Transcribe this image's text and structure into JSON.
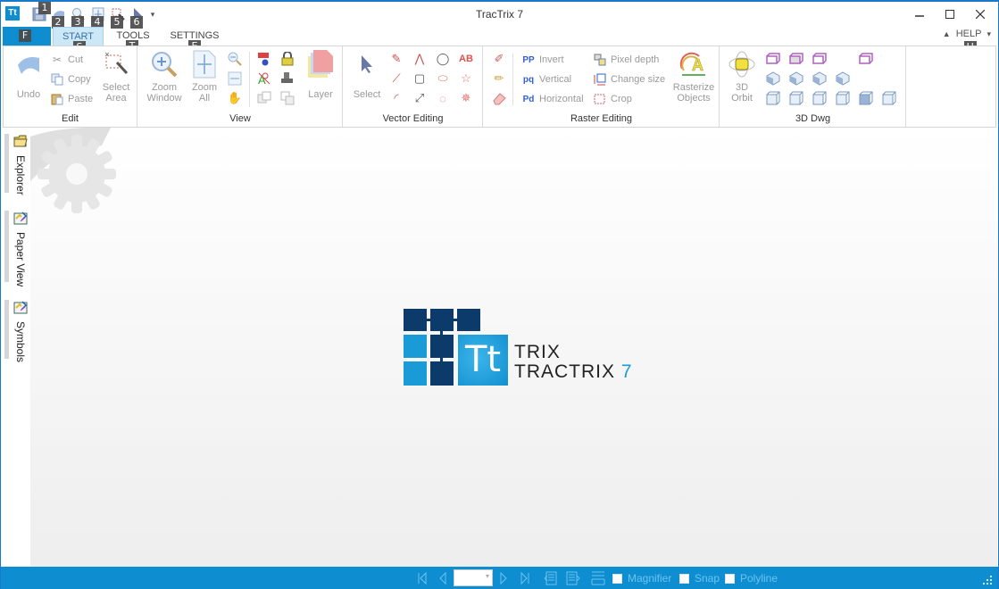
{
  "window": {
    "title": "TracTrix 7",
    "app_icon_text": "Tt",
    "minimize_icon": "minimize-icon",
    "maximize_icon": "maximize-icon",
    "close_icon": "close-icon"
  },
  "quick_access": {
    "items": [
      {
        "name": "save",
        "icon": "save-icon",
        "keytip": "1"
      },
      {
        "name": "undo",
        "icon": "undo-icon",
        "keytip": "2"
      },
      {
        "name": "zoom-window",
        "icon": "zoom-window-icon",
        "keytip": "3"
      },
      {
        "name": "zoom-all",
        "icon": "zoom-all-icon",
        "keytip": "4"
      },
      {
        "name": "select-area",
        "icon": "select-area-icon",
        "keytip": "5"
      },
      {
        "name": "select",
        "icon": "select-arrow-icon",
        "keytip": "6"
      }
    ],
    "customize_icon": "dropdown-arrow-icon"
  },
  "tabs": {
    "file_keytip": "F",
    "items": [
      {
        "label": "START",
        "keytip": "S",
        "active": true
      },
      {
        "label": "TOOLS",
        "keytip": "T",
        "active": false
      },
      {
        "label": "SETTINGS",
        "keytip": "E",
        "active": false
      }
    ],
    "help": {
      "label": "HELP",
      "keytip": "H"
    }
  },
  "ribbon": {
    "groups": {
      "edit": {
        "label": "Edit",
        "undo": "Undo",
        "cut": "Cut",
        "copy": "Copy",
        "paste": "Paste",
        "select_area": [
          "Select",
          "Area"
        ]
      },
      "view": {
        "label": "View",
        "zoom_window": [
          "Zoom",
          "Window"
        ],
        "zoom_all": [
          "Zoom",
          "All"
        ],
        "layer": "Layer"
      },
      "vector_editing": {
        "label": "Vector Editing",
        "select": "Select"
      },
      "raster_editing": {
        "label": "Raster Editing",
        "invert": "Invert",
        "vertical": "Vertical",
        "horizontal": "Horizontal",
        "pixel_depth": "Pixel depth",
        "change_size": "Change size",
        "crop": "Crop",
        "rasterize": [
          "Rasterize",
          "Objects"
        ]
      },
      "dwg3d": {
        "label": "3D Dwg",
        "orbit": [
          "3D",
          "Orbit"
        ]
      }
    }
  },
  "side_panel": {
    "tabs": [
      {
        "label": "Explorer",
        "icon": "folder-icon"
      },
      {
        "label": "Paper View",
        "icon": "paper-view-icon"
      },
      {
        "label": "Symbols",
        "icon": "symbols-icon"
      }
    ]
  },
  "splash": {
    "logo_mark": "Tt",
    "line1": "TRIX",
    "line2": "TRACTRIX",
    "version": "7",
    "colors": {
      "dark": "#0b3a6b",
      "light": "#1a9ad6"
    }
  },
  "status_bar": {
    "page_value": "",
    "magnifier": {
      "label": "Magnifier",
      "checked": false
    },
    "snap": {
      "label": "Snap",
      "checked": false
    },
    "polyline": {
      "label": "Polyline",
      "checked": false
    }
  },
  "colors": {
    "accent": "#0e8ed1",
    "tab_active_bg": "#cce8f7"
  }
}
